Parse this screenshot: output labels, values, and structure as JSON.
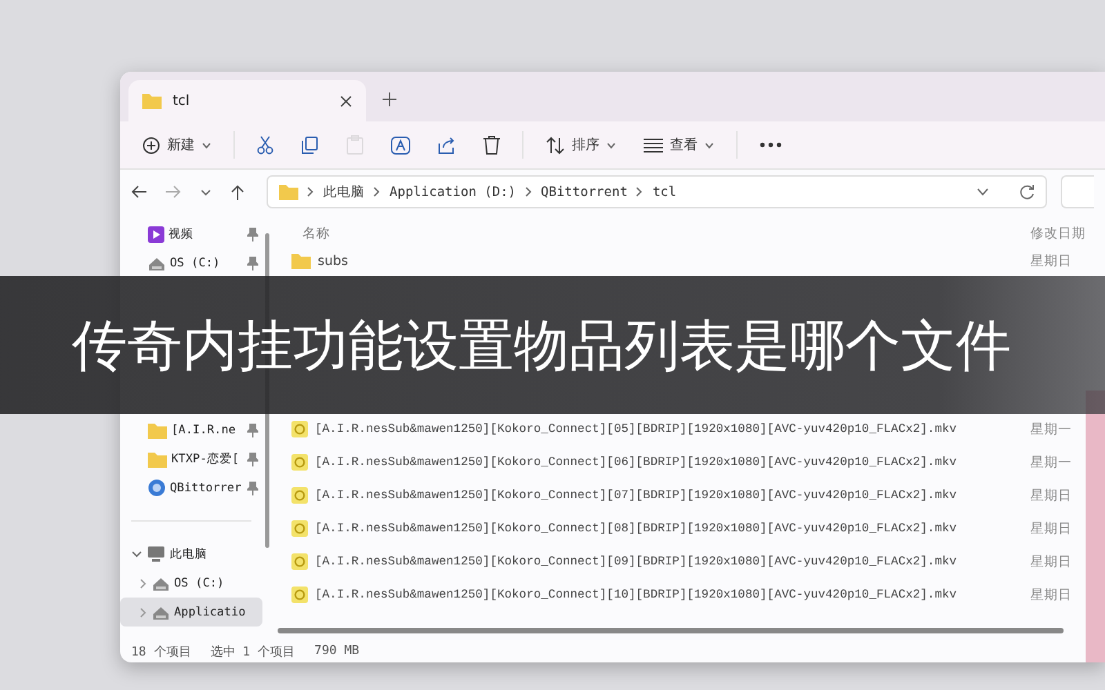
{
  "tabs": [
    {
      "title": "tcl",
      "selected": true
    }
  ],
  "toolbar": [
    {
      "kind": "new",
      "label": "新建",
      "disabled": false
    },
    {
      "kind": "cut",
      "disabled": false
    },
    {
      "kind": "copy",
      "disabled": false
    },
    {
      "kind": "paste",
      "disabled": true
    },
    {
      "kind": "rename",
      "disabled": false
    },
    {
      "kind": "share",
      "disabled": false
    },
    {
      "kind": "delete",
      "disabled": false
    },
    {
      "kind": "sort",
      "label": "排序",
      "disabled": false
    },
    {
      "kind": "view",
      "label": "查看",
      "disabled": false
    },
    {
      "kind": "more",
      "disabled": false
    }
  ],
  "address_bar": {
    "crumbs": [
      "此电脑",
      "Application (D:)",
      "QBittorrent",
      "tcl"
    ]
  },
  "sidebar": {
    "quick_access": [
      {
        "label": "视频",
        "kind": "video",
        "pinned": true
      },
      {
        "label": "OS (C:)",
        "kind": "drive",
        "pinned": true
      },
      {
        "label": "[A.I.R.ne",
        "kind": "folder",
        "pinned": true
      },
      {
        "label": "KTXP-恋爱[",
        "kind": "folder",
        "pinned": true
      },
      {
        "label": "QBittorrer",
        "kind": "app",
        "pinned": true
      }
    ],
    "this_pc": {
      "label": "此电脑",
      "expanded": true,
      "children": [
        {
          "label": "OS (C:)",
          "kind": "drive",
          "expanded": false,
          "selected": false
        },
        {
          "label": "Applicatio",
          "kind": "drive",
          "expanded": false,
          "selected": true
        }
      ]
    }
  },
  "file_list": {
    "columns": [
      "名称",
      "修改日期"
    ],
    "rows": [
      {
        "kind": "folder",
        "name": "subs",
        "date": "星期日"
      },
      {
        "kind": "video",
        "name": "[A.I.R.nesSub&mawen1250][Kokoro_Connect][05][BDRIP][1920x1080][AVC-yuv420p10_FLACx2].mkv",
        "date": "星期一"
      },
      {
        "kind": "video",
        "name": "[A.I.R.nesSub&mawen1250][Kokoro_Connect][06][BDRIP][1920x1080][AVC-yuv420p10_FLACx2].mkv",
        "date": "星期一"
      },
      {
        "kind": "video",
        "name": "[A.I.R.nesSub&mawen1250][Kokoro_Connect][07][BDRIP][1920x1080][AVC-yuv420p10_FLACx2].mkv",
        "date": "星期日"
      },
      {
        "kind": "video",
        "name": "[A.I.R.nesSub&mawen1250][Kokoro_Connect][08][BDRIP][1920x1080][AVC-yuv420p10_FLACx2].mkv",
        "date": "星期日"
      },
      {
        "kind": "video",
        "name": "[A.I.R.nesSub&mawen1250][Kokoro_Connect][09][BDRIP][1920x1080][AVC-yuv420p10_FLACx2].mkv",
        "date": "星期日"
      },
      {
        "kind": "video",
        "name": "[A.I.R.nesSub&mawen1250][Kokoro_Connect][10][BDRIP][1920x1080][AVC-yuv420p10_FLACx2].mkv",
        "date": "星期日"
      }
    ]
  },
  "status_bar": [
    "18 个项目",
    "选中 1 个项目",
    "790 MB"
  ],
  "banner": {
    "title": "传奇内挂功能设置物品列表是哪个文件"
  }
}
